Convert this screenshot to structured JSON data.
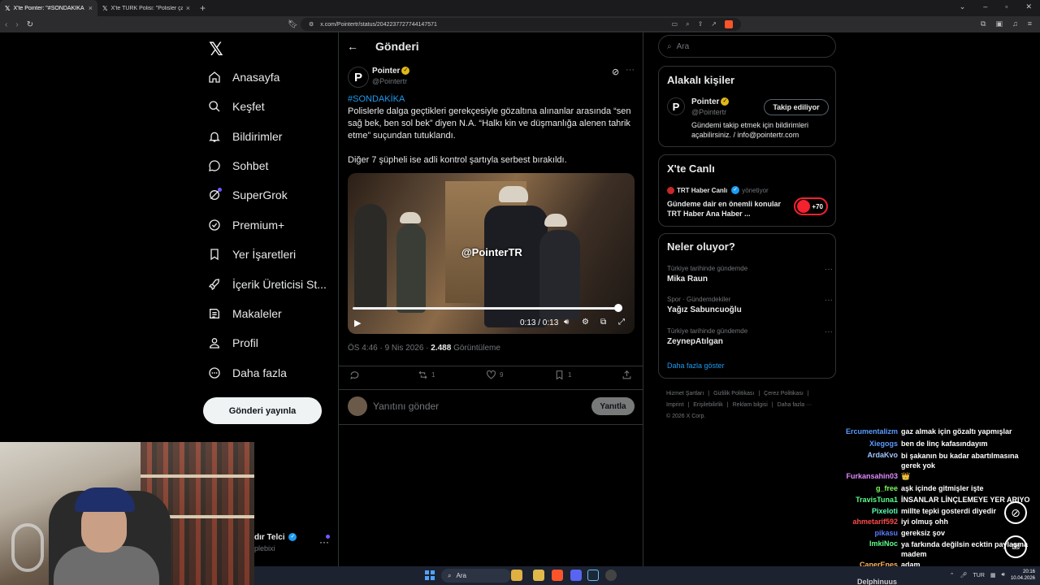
{
  "browser": {
    "tabs": [
      {
        "label": "X'te Pointer: \"#SONDAKİKA Poli...",
        "active": true
      },
      {
        "label": "X'te TÜRK Polisi: \"Polisler çatışmaya g...",
        "active": false
      }
    ],
    "url": "x.com/Pointertr/status/2042237727744147571"
  },
  "nav": {
    "items": [
      {
        "label": "Anasayfa",
        "icon": "home-icon"
      },
      {
        "label": "Keşfet",
        "icon": "search-icon"
      },
      {
        "label": "Bildirimler",
        "icon": "bell-icon"
      },
      {
        "label": "Sohbet",
        "icon": "chat-icon"
      },
      {
        "label": "SuperGrok",
        "icon": "grok-icon"
      },
      {
        "label": "Premium+",
        "icon": "premium-icon"
      },
      {
        "label": "Yer İşaretleri",
        "icon": "bookmark-icon"
      },
      {
        "label": "İçerik Üreticisi St...",
        "icon": "rocket-icon"
      },
      {
        "label": "Makaleler",
        "icon": "article-icon"
      },
      {
        "label": "Profil",
        "icon": "person-icon"
      },
      {
        "label": "Daha fazla",
        "icon": "more-circle-icon"
      }
    ],
    "post_button": "Gönderi yayınla",
    "account_name": "dır Telci",
    "account_handle": "plebixi"
  },
  "post": {
    "header_title": "Gönderi",
    "author_name": "Pointer",
    "author_handle": "@Pointertr",
    "hashtag": "#SONDAKİKA",
    "text": "Polislerle dalga geçtikleri gerekçesiyle gözaltına alınanlar arasında “sen sağ bek, ben sol bek” diyen N.A. “Halkı kin ve düşmanlığa alenen tahrik etme” suçundan tutuklandı.",
    "text2": "Diğer 7 şüpheli ise adli kontrol şartıyla serbest bırakıldı.",
    "video": {
      "watermark": "@PointerTR",
      "time": "0:13 / 0:13",
      "progress": 1.0
    },
    "meta_time": "ÖS 4:46 · 9 Nis 2026 · ",
    "views": "2.488",
    "views_label": " Görüntüleme",
    "actions": {
      "reply": "",
      "repost": "1",
      "like": "9",
      "bookmark": "1"
    },
    "reply_placeholder": "Yanıtını gönder",
    "reply_button": "Yanıtla"
  },
  "sidebar": {
    "search_placeholder": "Ara",
    "related_title": "Alakalı kişiler",
    "related_name": "Pointer",
    "related_handle": "@Pointertr",
    "follow_button": "Takip ediliyor",
    "related_bio": "Gündemi takip etmek için bildirimleri açabilirsiniz. / info@pointertr.com",
    "live_title": "X'te Canlı",
    "live_host": "TRT Haber Canlı",
    "live_host_role": "yönetiyor",
    "live_text": "Gündeme dair en önemli konular TRT Haber Ana Haber ...",
    "live_count": "+70",
    "trends_title": "Neler oluyor?",
    "trends": [
      {
        "category": "Türkiye tarihinde gündemde",
        "name": "Mika Raun"
      },
      {
        "category": "Spor · Gündemdekiler",
        "name": "Yağız Sabuncuoğlu"
      },
      {
        "category": "Türkiye tarihinde gündemde",
        "name": "ZeynepAtılgan"
      }
    ],
    "show_more": "Daha fazla göster",
    "footer_line1": [
      "Hizmet Şartları",
      "|",
      "Gizlilik Politikası",
      "|",
      "Çerez Politikası",
      "|"
    ],
    "footer_line2": [
      "Imprint",
      "|",
      "Erişilebilirlik",
      "|",
      "Reklam bilgisi",
      "|",
      "Daha fazla ···"
    ],
    "footer_line3": "© 2026 X Corp."
  },
  "chat": [
    {
      "user": "Ercumentalizm",
      "color": "#5b9bff",
      "msg": "gaz almak için gözaltı yapmışlar"
    },
    {
      "user": "Xiegogs",
      "color": "#5b9bff",
      "msg": "ben de linç kafasındayım"
    },
    {
      "user": "ArdaKvo",
      "color": "#9ec7ff",
      "msg": "bi şakanın bu kadar abartılmasına gerek yok"
    },
    {
      "user": "Furkansahin03",
      "color": "#e08aff",
      "msg": "👑"
    },
    {
      "user": "g_free",
      "color": "#7dff5b",
      "msg": "aşk içinde gitmişler işte"
    },
    {
      "user": "TravisTuna1",
      "color": "#5bff8a",
      "msg": "İNSANLAR LİNÇLEMEYE YER ARIYO"
    },
    {
      "user": "Pixeloti",
      "color": "#5bffb5",
      "msg": "millte tepki gosterdi diyedir"
    },
    {
      "user": "ahmetarif592",
      "color": "#ff4a4a",
      "msg": "iyi olmuş ohh"
    },
    {
      "user": "pikasu",
      "color": "#5b7bff",
      "msg": "gereksiz şov"
    },
    {
      "user": "ImkiNoc",
      "color": "#5bff8a",
      "msg": "ya farkında değilsin ecktin paylaşma madem"
    },
    {
      "user": "CanerEnes",
      "color": "#ffb55b",
      "msg": "adam"
    },
    {
      "user": "Delphinuus",
      "color": "#cccccc",
      "msg": ""
    }
  ],
  "taskbar": {
    "search": "Ara",
    "lang": "TUR",
    "time": "20:16",
    "date": "10.04.2026"
  }
}
